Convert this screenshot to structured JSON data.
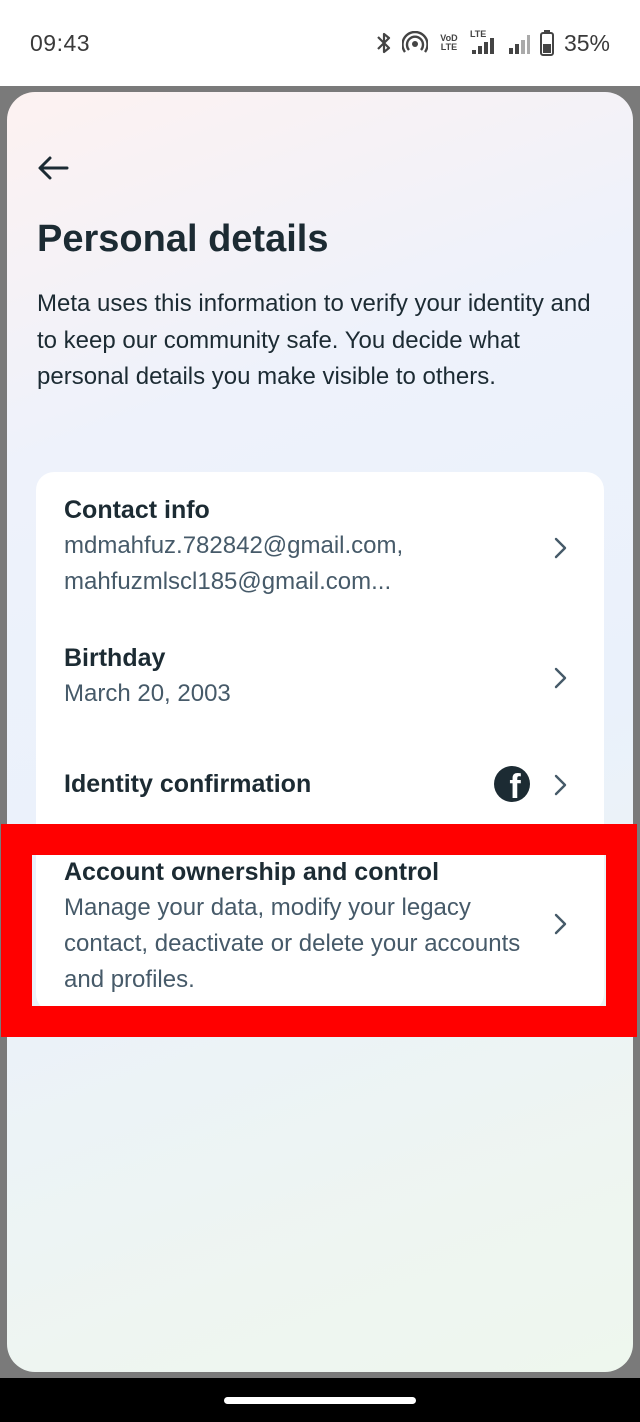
{
  "status_bar": {
    "time": "09:43",
    "battery": "35%",
    "icons": [
      "bluetooth-icon",
      "hotspot-icon",
      "volte-icon",
      "lte-signal-icon",
      "signal-icon",
      "battery-icon"
    ],
    "volte_label": "VoD LTE",
    "lte_label": "LTE"
  },
  "header": {
    "back_icon": "arrow-left-icon",
    "title": "Personal details",
    "description": "Meta uses this information to verify your identity and to keep our community safe. You decide what personal details you make visible to others."
  },
  "items": [
    {
      "title": "Contact info",
      "subtitle_line1": "mdmahfuz.782842@gmail.com,",
      "subtitle_line2": "mahfuzmlscl185@gmail.com..."
    },
    {
      "title": "Birthday",
      "subtitle": "March 20, 2003"
    },
    {
      "title": "Identity confirmation",
      "icon": "facebook-icon"
    },
    {
      "title": "Account ownership and control",
      "subtitle": "Manage your data, modify your legacy contact, deactivate or delete your accounts and profiles."
    }
  ],
  "colors": {
    "highlight": "#ff0000",
    "text_primary": "#1c2b33",
    "text_secondary": "#465a69"
  }
}
